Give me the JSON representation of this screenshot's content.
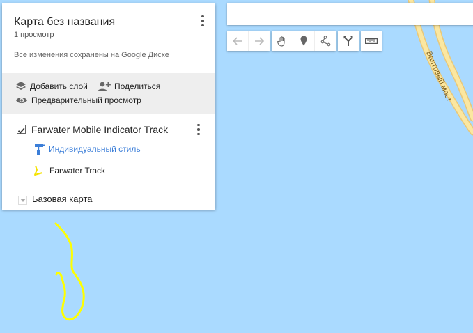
{
  "map": {
    "water_color": "#aadaff",
    "road_color": "#f5dc8a",
    "track_color": "#ffff00",
    "road_label": "Вантовый мост"
  },
  "panel": {
    "title": "Карта без названия",
    "views": "1 просмотр",
    "save_status": "Все изменения сохранены на Google Диске",
    "menu_icon": "more-vert-icon"
  },
  "actions": {
    "add_layer": "Добавить слой",
    "share": "Поделиться",
    "preview": "Предварительный просмотр"
  },
  "layer": {
    "name": "Farwater Mobile Indicator Track",
    "checked": true,
    "style_label": "Индивидуальный стиль",
    "style_color": "#3b7ed8",
    "track_label": "Farwater Track"
  },
  "basemap": {
    "label": "Базовая карта"
  },
  "search": {
    "placeholder": ""
  },
  "toolbar": {
    "undo_icon": "undo-icon",
    "redo_icon": "redo-icon",
    "hand_icon": "hand-icon",
    "marker_icon": "marker-icon",
    "line_icon": "draw-line-icon",
    "directions_icon": "directions-icon",
    "ruler_icon": "ruler-icon"
  }
}
